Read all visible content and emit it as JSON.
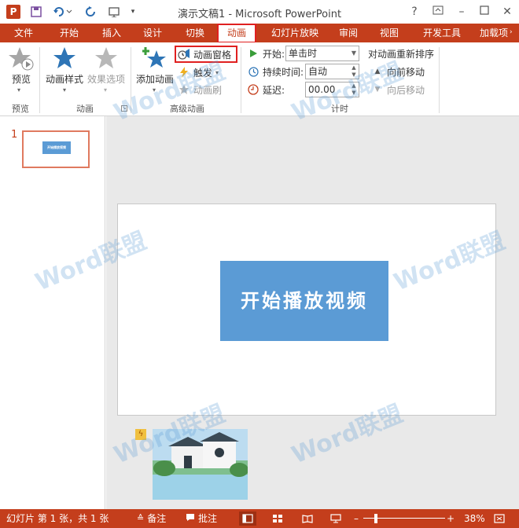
{
  "titlebar": {
    "app_badge": "P",
    "title": "演示文稿1 - Microsoft PowerPoint",
    "help": "?",
    "minimize": "–",
    "close": "✕"
  },
  "tabs": [
    {
      "label": "文件"
    },
    {
      "label": "开始"
    },
    {
      "label": "插入"
    },
    {
      "label": "设计"
    },
    {
      "label": "切换"
    },
    {
      "label": "动画",
      "active": true
    },
    {
      "label": "幻灯片放映"
    },
    {
      "label": "审阅"
    },
    {
      "label": "视图"
    },
    {
      "label": "开发工具"
    },
    {
      "label": "加载项"
    }
  ],
  "ribbon": {
    "preview": {
      "button": "预览",
      "group": "预览"
    },
    "animation": {
      "styles": "动画样式",
      "effects": "效果选项",
      "group": "动画"
    },
    "advanced": {
      "add": "添加动画",
      "pane": "动画窗格",
      "trigger": "触发",
      "painter": "动画刷",
      "group": "高级动画"
    },
    "timing": {
      "start_label": "开始:",
      "start_value": "单击时",
      "duration_label": "持续时间:",
      "duration_value": "自动",
      "delay_label": "延迟:",
      "delay_value": "00.00",
      "reorder": "对动画重新排序",
      "forward": "向前移动",
      "backward": "向后移动",
      "group": "计时"
    }
  },
  "thumbnails": {
    "slide_number": "1",
    "thumb_text": "开始播放视频"
  },
  "slide": {
    "title": "开始播放视频"
  },
  "watermark": "Word联盟",
  "statusbar": {
    "slide_info": "幻灯片 第 1 张，共 1 张",
    "notes": "备注",
    "comments": "批注",
    "zoom_minus": "–",
    "zoom_plus": "+",
    "zoom": "38%",
    "zoom_level": 0.38
  },
  "colors": {
    "accent": "#c43e1c",
    "highlight": "#e02020",
    "title_box": "#5b9bd5"
  }
}
